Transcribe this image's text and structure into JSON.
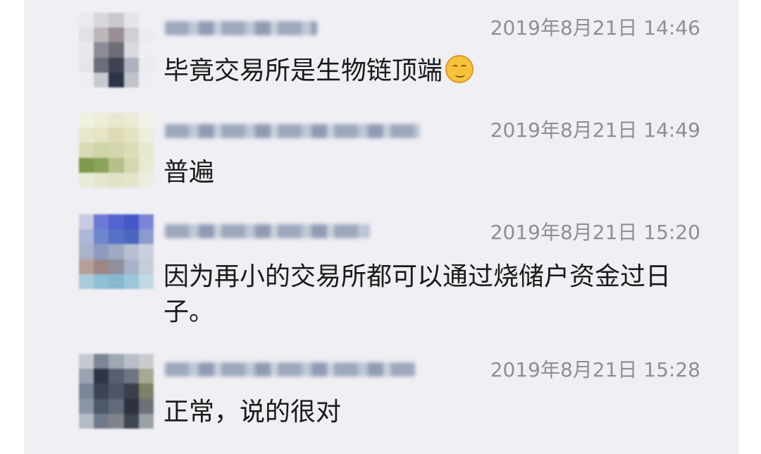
{
  "messages": [
    {
      "time": "2019年8月21日 14:46",
      "text": "毕竟交易所是生物链顶端",
      "emoji": "smirk-face-icon",
      "avatar_colors": [
        "#e9e9ee",
        "#d7d7de",
        "#c9c9cf",
        "#e6e6ea",
        "#f0f0f3",
        "#e2e2e6",
        "#bdb6b8",
        "#9a8e94",
        "#d0cfd5",
        "#ececef",
        "#e8e8ec",
        "#8d8c95",
        "#6d6d78",
        "#d9d9de",
        "#efeff2",
        "#e6e6ea",
        "#6b6e7a",
        "#3e4354",
        "#aeb2bc",
        "#ececef",
        "#eeeef1",
        "#c7c9d0",
        "#2c3448",
        "#c1c3cb",
        "#efeff2"
      ]
    },
    {
      "time": "2019年8月21日 14:49",
      "text": "普遍",
      "avatar_colors": [
        "#f1f1e1",
        "#eeeed8",
        "#e9e8cf",
        "#ecebd6",
        "#f2f2e6",
        "#e7e7cc",
        "#e5e4c4",
        "#dedcb6",
        "#e3e2c2",
        "#eeeedc",
        "#d9dbb4",
        "#cfd5a6",
        "#d3d6ac",
        "#dcdcb9",
        "#e8e8d2",
        "#7e9a4c",
        "#8aa45a",
        "#b5c08a",
        "#d6d7b0",
        "#e9e9d4",
        "#eaeadb",
        "#e6e6cd",
        "#e2e2c6",
        "#e4e4cb",
        "#ededdf"
      ]
    },
    {
      "time": "2019年8月21日 15:20",
      "text": "因为再小的交易所都可以通过烧储户资金过日子。",
      "avatar_colors": [
        "#c8cbe2",
        "#6b78d6",
        "#5463cf",
        "#4756c8",
        "#7a86d8",
        "#aeb7da",
        "#6d86cc",
        "#5572c4",
        "#4b66be",
        "#8b9bd0",
        "#a9b4c9",
        "#8b9cc0",
        "#9fa9c4",
        "#b9bfd1",
        "#c9cfdc",
        "#b69f98",
        "#9e8782",
        "#8f8f9e",
        "#a8b3c7",
        "#c7ccd9",
        "#a9cbd9",
        "#8fc0d6",
        "#86b9d1",
        "#9cc6d9",
        "#c1d9e3"
      ]
    },
    {
      "time": "2019年8月21日 15:28",
      "text": "正常，说的很对",
      "avatar_colors": [
        "#c5cad2",
        "#7c8695",
        "#9fa7b1",
        "#b8bfc6",
        "#c9cbcc",
        "#9aa3b0",
        "#2f3545",
        "#566072",
        "#6e7683",
        "#a7a993",
        "#7a8597",
        "#3b4355",
        "#4d5566",
        "#3a3f4b",
        "#7d8167",
        "#8c95a3",
        "#4f5868",
        "#606a7a",
        "#2d3240",
        "#6c7078",
        "#b5bcc6",
        "#707c8c",
        "#80838a",
        "#3f4552",
        "#9aa0a8"
      ]
    }
  ]
}
